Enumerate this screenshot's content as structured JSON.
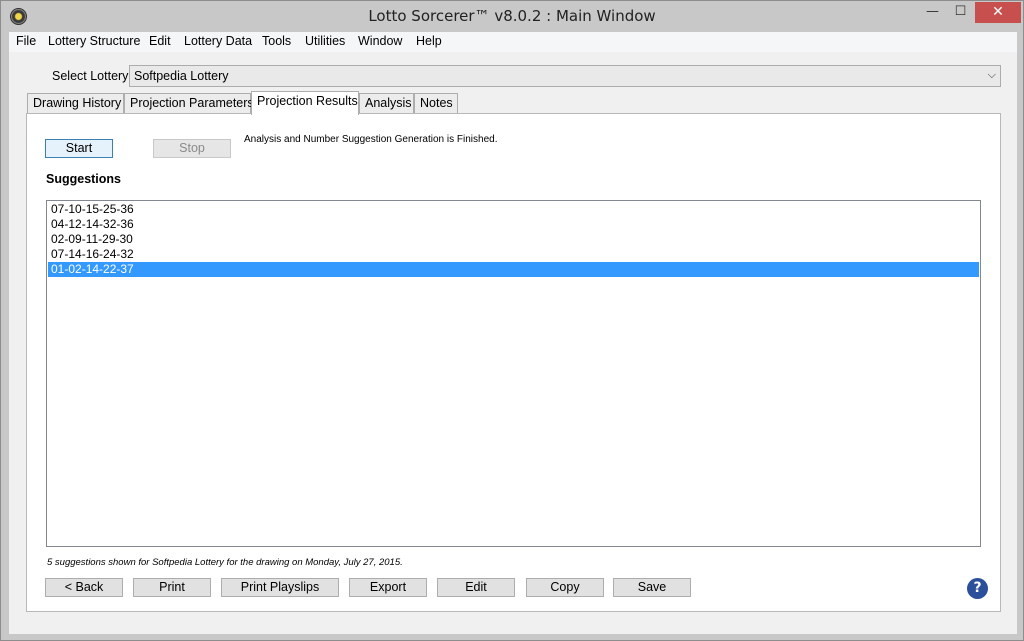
{
  "window": {
    "title": "Lotto Sorcerer™ v8.0.2 : Main Window",
    "controls": {
      "minimize": "—",
      "maximize": "☐",
      "close": "✕"
    }
  },
  "menu": {
    "items": [
      "File",
      "Lottery Structure",
      "Edit",
      "Lottery Data",
      "Tools",
      "Utilities",
      "Window",
      "Help"
    ]
  },
  "lottery_select": {
    "label": "Select Lottery:",
    "value": "Softpedia Lottery",
    "arrow": "⌵"
  },
  "tabs": [
    {
      "label": "Drawing History",
      "active": false
    },
    {
      "label": "Projection Parameters",
      "active": false
    },
    {
      "label": "Projection Results",
      "active": true
    },
    {
      "label": "Analysis",
      "active": false
    },
    {
      "label": "Notes",
      "active": false
    }
  ],
  "projection": {
    "start_label": "Start",
    "stop_label": "Stop",
    "status": "Analysis and Number Suggestion Generation is Finished.",
    "suggestions_heading": "Suggestions",
    "suggestions": [
      "07-10-15-25-36",
      "04-12-14-32-36",
      "02-09-11-29-30",
      "07-14-16-24-32",
      "01-02-14-22-37"
    ],
    "selected_index": 4,
    "footer": "5 suggestions shown for Softpedia Lottery for the drawing on Monday, July 27, 2015."
  },
  "actions": {
    "back": "< Back",
    "print": "Print",
    "print_playslips": "Print Playslips",
    "export": "Export",
    "edit": "Edit",
    "copy": "Copy",
    "save": "Save",
    "help": "?"
  }
}
